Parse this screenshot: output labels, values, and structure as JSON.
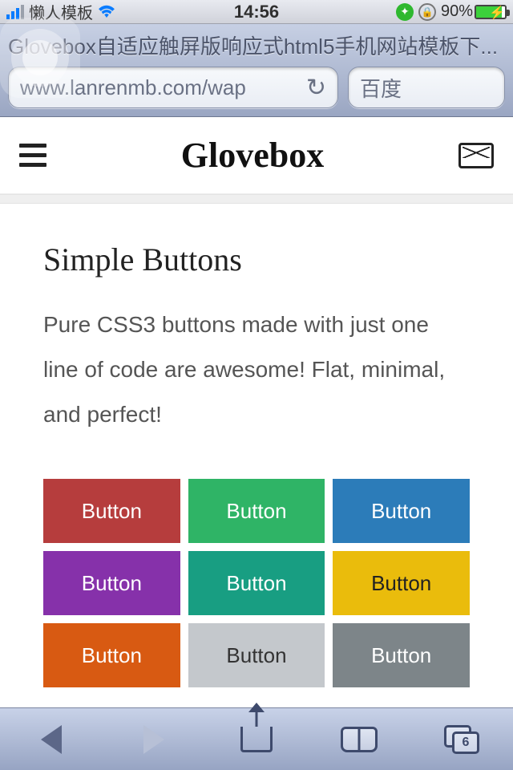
{
  "statusbar": {
    "carrier": "懒人模板",
    "time": "14:56",
    "battery_pct": "90%"
  },
  "browser": {
    "page_title": "Glovebox自适应触屏版响应式html5手机网站模板下...",
    "url": "www.lanrenmb.com/wap",
    "search_placeholder": "百度",
    "tab_count": "6"
  },
  "app": {
    "brand": "Glovebox"
  },
  "content": {
    "heading": "Simple Buttons",
    "lead": "Pure CSS3 buttons made with just one line of code are awesome! Flat, minimal, and perfect!",
    "buttons": [
      {
        "label": "Button",
        "color": "red"
      },
      {
        "label": "Button",
        "color": "green"
      },
      {
        "label": "Button",
        "color": "blue"
      },
      {
        "label": "Button",
        "color": "purple"
      },
      {
        "label": "Button",
        "color": "teal"
      },
      {
        "label": "Button",
        "color": "yellow"
      },
      {
        "label": "Button",
        "color": "orange"
      },
      {
        "label": "Button",
        "color": "silver"
      },
      {
        "label": "Button",
        "color": "gray"
      }
    ]
  },
  "colors": {
    "red": "#b63d3d",
    "green": "#2fb466",
    "blue": "#2c7cb9",
    "purple": "#8631aa",
    "teal": "#189e82",
    "yellow": "#eabc0c",
    "orange": "#d85a12",
    "silver": "#c4c8cc",
    "gray": "#7d8589"
  }
}
